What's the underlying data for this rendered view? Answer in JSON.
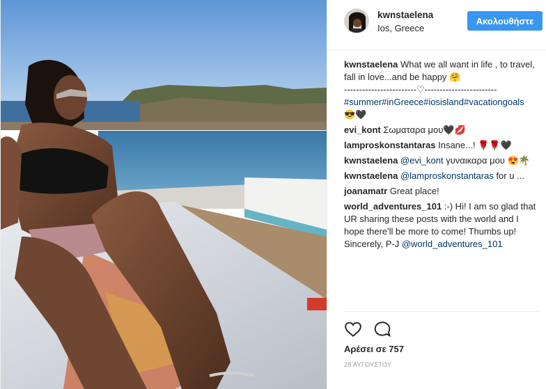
{
  "post": {
    "username": "kwnstaelena",
    "location": "Ios, Greece",
    "follow_label": "Ακολουθήστε",
    "likes": "Αρέσει σε 757",
    "date": "28 ΑΥΓΟΥΣΤΟΥ"
  },
  "caption": {
    "username": "kwnstaelena",
    "text": " What we all want in life , to travel, fall in love...and be happy 🤗",
    "separator": "------------------------♡------------------------",
    "hashtags": "#summer#inGreece#iosisland#vacationgoals",
    "emoji": "😎🖤"
  },
  "comments": [
    {
      "user": "evi_kont",
      "text": " Σωματαρα μου🖤💋"
    },
    {
      "user": "lamproskonstantaras",
      "text": " Insane...! 🌹🌹🖤"
    },
    {
      "user": "kwnstaelena",
      "mention": "@evi_kont",
      "text": " γυναικαρα μου 😍🌴"
    },
    {
      "user": "kwnstaelena",
      "mention": "@lamproskonstantaras",
      "text": " for u ..."
    },
    {
      "user": "joanamatr",
      "text": " Great place!"
    },
    {
      "user": "world_adventures_101",
      "text": " :-) Hi! I am so glad that UR sharing these posts with the world and I hope there'll be more to come! Thumbs up!",
      "signoff": "Sincerely, P-J ",
      "signoff_mention": "@world_adventures_101"
    }
  ],
  "icons": {
    "like": "heart-icon",
    "comment": "comment-bubble-icon"
  },
  "colors": {
    "follow_button": "#3897f0",
    "link": "#003569"
  }
}
